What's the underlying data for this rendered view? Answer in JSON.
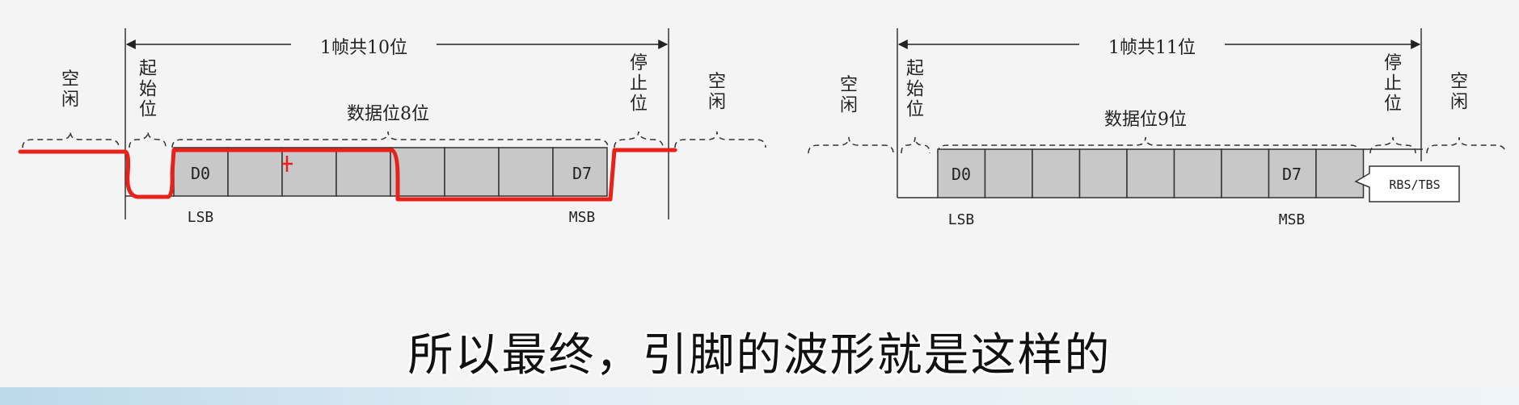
{
  "diagram_left": {
    "frame_title": "1帧共10位",
    "idle_left": "空闲",
    "start_bit": "起始位",
    "data_bits": "数据位8位",
    "stop_bit": "停止位",
    "idle_right": "空闲",
    "first_cell": "D0",
    "last_cell": "D7",
    "lsb": "LSB",
    "msb": "MSB"
  },
  "diagram_right": {
    "frame_title": "1帧共11位",
    "idle_left": "空闲",
    "start_bit": "起始位",
    "data_bits": "数据位9位",
    "stop_bit": "停止位",
    "idle_right": "空闲",
    "first_cell": "D0",
    "last_cell": "D7",
    "lsb": "LSB",
    "msb": "MSB",
    "callout": "RBS/TBS"
  },
  "subtitle": "所以最终，引脚的波形就是这样的",
  "colors": {
    "annotation": "#e8211a",
    "cell_fill": "#c8c8c8",
    "line": "#333333"
  }
}
